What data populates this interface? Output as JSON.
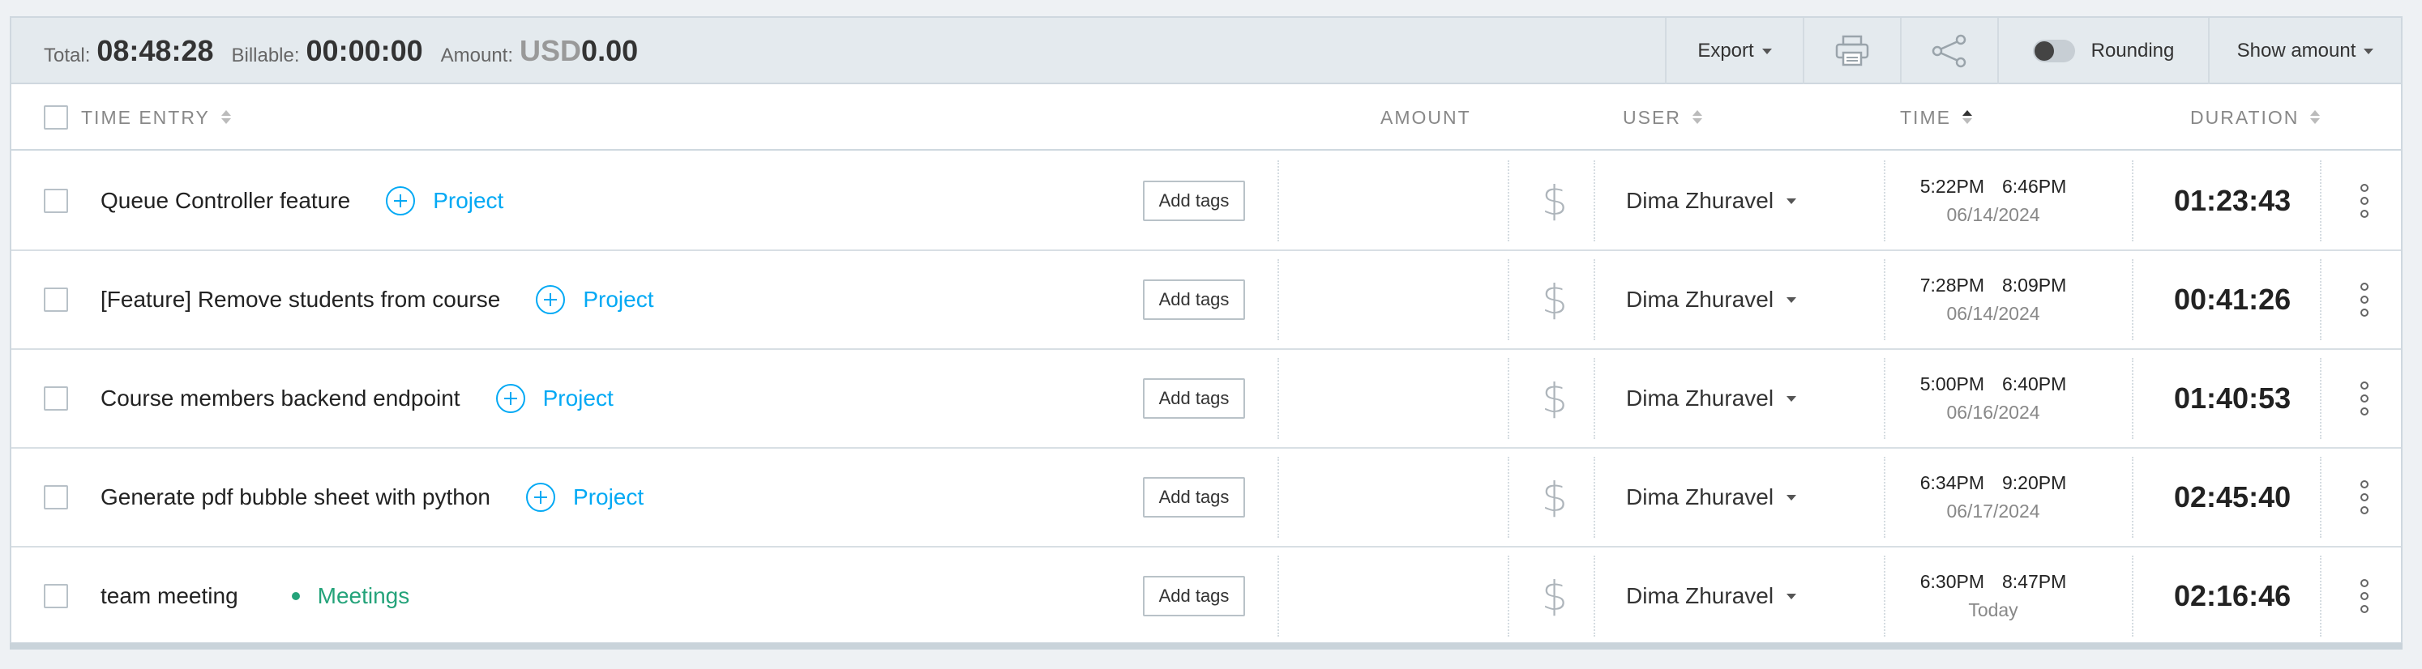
{
  "summary": {
    "total_label": "Total:",
    "total_value": "08:48:28",
    "billable_label": "Billable:",
    "billable_value": "00:00:00",
    "amount_label": "Amount:",
    "amount_currency": "USD",
    "amount_value": "0.00"
  },
  "toolbar": {
    "export_label": "Export",
    "print_icon": "printer-icon",
    "share_icon": "share-icon",
    "rounding_label": "Rounding",
    "rounding_on": false,
    "show_amount_label": "Show amount"
  },
  "columns": {
    "time_entry": "TIME ENTRY",
    "amount": "AMOUNT",
    "user": "USER",
    "time": "TIME",
    "duration": "DURATION"
  },
  "tags_button_label": "Add tags",
  "project_placeholder": "Project",
  "colors": {
    "accent": "#03a9f4",
    "meetings": "#24a37a"
  },
  "entries": [
    {
      "description": "Queue Controller feature",
      "project": "Project",
      "project_set": false,
      "user": "Dima Zhuravel",
      "start": "5:22PM",
      "end": "6:46PM",
      "date": "06/14/2024",
      "duration": "01:23:43"
    },
    {
      "description": "[Feature] Remove students from course",
      "project": "Project",
      "project_set": false,
      "user": "Dima Zhuravel",
      "start": "7:28PM",
      "end": "8:09PM",
      "date": "06/14/2024",
      "duration": "00:41:26"
    },
    {
      "description": "Course members backend endpoint",
      "project": "Project",
      "project_set": false,
      "user": "Dima Zhuravel",
      "start": "5:00PM",
      "end": "6:40PM",
      "date": "06/16/2024",
      "duration": "01:40:53"
    },
    {
      "description": "Generate pdf bubble sheet with python",
      "project": "Project",
      "project_set": false,
      "user": "Dima Zhuravel",
      "start": "6:34PM",
      "end": "9:20PM",
      "date": "06/17/2024",
      "duration": "02:45:40"
    },
    {
      "description": "team meeting",
      "project": "Meetings",
      "project_set": true,
      "user": "Dima Zhuravel",
      "start": "6:30PM",
      "end": "8:47PM",
      "date": "Today",
      "duration": "02:16:46"
    }
  ]
}
